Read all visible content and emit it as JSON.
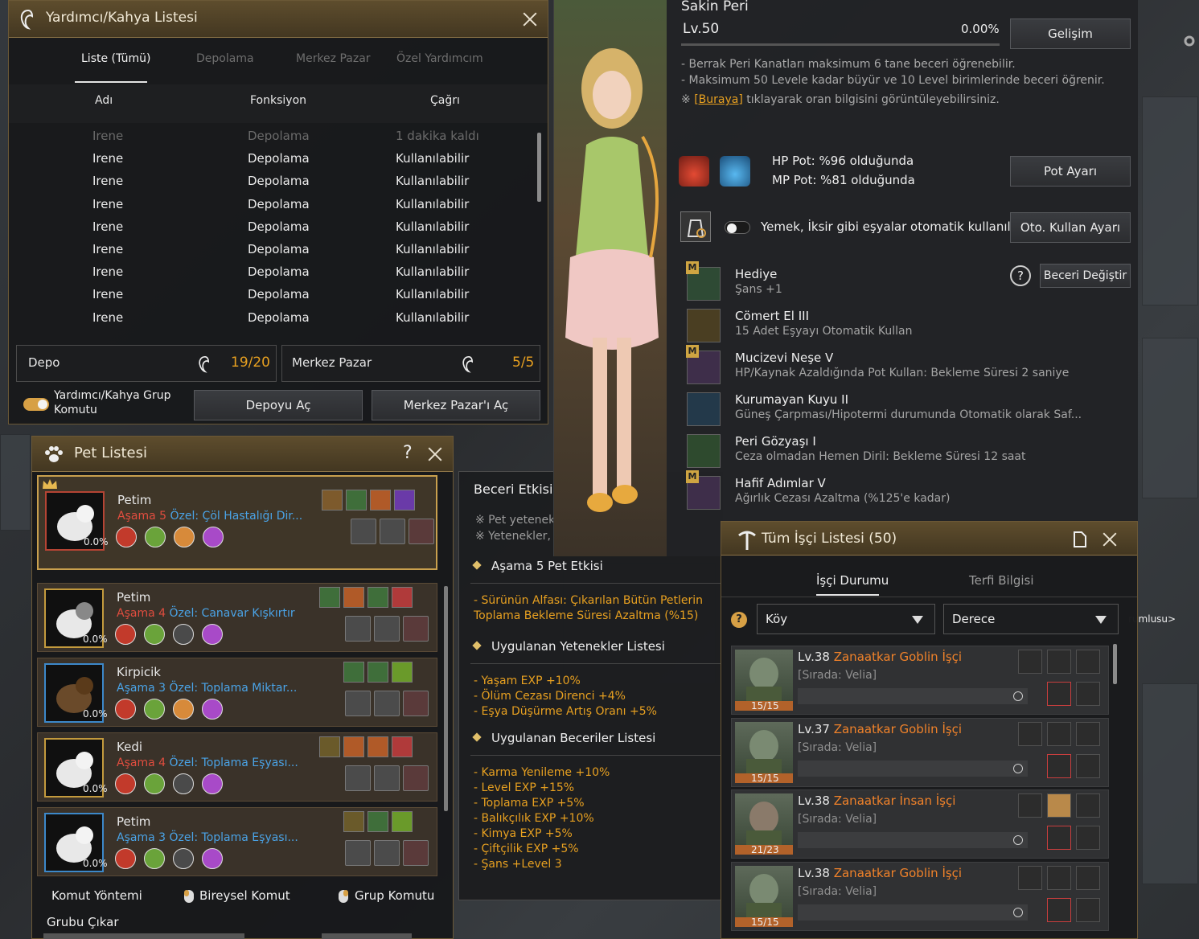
{
  "helper": {
    "title": "Yardımcı/Kahya Listesi",
    "tabs": [
      "Liste (Tümü)",
      "Depolama",
      "Merkez Pazar",
      "Özel Yardımcım"
    ],
    "columns": [
      "Adı",
      "Fonksiyon",
      "Çağrı"
    ],
    "rows": [
      {
        "name": "Irene",
        "function": "Depolama",
        "call": "1 dakika kaldı",
        "dim": true
      },
      {
        "name": "Irene",
        "function": "Depolama",
        "call": "Kullanılabilir"
      },
      {
        "name": "Irene",
        "function": "Depolama",
        "call": "Kullanılabilir"
      },
      {
        "name": "Irene",
        "function": "Depolama",
        "call": "Kullanılabilir"
      },
      {
        "name": "Irene",
        "function": "Depolama",
        "call": "Kullanılabilir"
      },
      {
        "name": "Irene",
        "function": "Depolama",
        "call": "Kullanılabilir"
      },
      {
        "name": "Irene",
        "function": "Depolama",
        "call": "Kullanılabilir"
      },
      {
        "name": "Irene",
        "function": "Depolama",
        "call": "Kullanılabilir"
      },
      {
        "name": "Irene",
        "function": "Depolama",
        "call": "Kullanılabilir"
      }
    ],
    "storage_label": "Depo",
    "storage_count": "19/20",
    "market_label": "Merkez Pazar",
    "market_count": "5/5",
    "group_command_label": "Yardımcı/Kahya Grup Komutu",
    "open_storage": "Depoyu Aç",
    "open_market": "Merkez Pazar'ı Aç"
  },
  "pets": {
    "title": "Pet Listesi",
    "help": "?",
    "items": [
      {
        "name": "Petim",
        "stage_label": "Aşama",
        "stage": "5",
        "special": "Özel: Çöl Hastalığı Dir...",
        "pct": "0.0%",
        "stage_color": "#e14d3f"
      },
      {
        "name": "Petim",
        "stage_label": "Aşama",
        "stage": "4",
        "special": "Özel: Canavar Kışkırtır",
        "pct": "0.0%",
        "stage_color": "#e14d3f"
      },
      {
        "name": "Kirpicik",
        "stage_label": "Aşama",
        "stage": "3",
        "special": "Özel: Toplama Miktar...",
        "pct": "0.0%",
        "stage_color": "#4aa3e6"
      },
      {
        "name": "Kedi",
        "stage_label": "Aşama",
        "stage": "4",
        "special": "Özel: Toplama Eşyası...",
        "pct": "0.0%",
        "stage_color": "#e14d3f"
      },
      {
        "name": "Petim",
        "stage_label": "Aşama",
        "stage": "3",
        "special": "Özel: Toplama Eşyası...",
        "pct": "0.0%",
        "stage_color": "#4aa3e6"
      }
    ],
    "command_method": "Komut Yöntemi",
    "individual_command": "Bireysel Komut",
    "group_command": "Grup Komutu",
    "remove_group": "Grubu Çıkar"
  },
  "skill_effect": {
    "title": "Beceri Etkisi",
    "notes": [
      "※ Pet yetenek",
      "※ Yetenekler,"
    ],
    "stage_effect_title": "Aşama 5 Pet Etkisi",
    "stage_effect_text": [
      "- Sürünün Alfası: Çıkarılan Bütün Petlerin",
      "Toplama Bekleme Süresi Azaltma (%15)"
    ],
    "applied_talents_title": "Uygulanan Yetenekler Listesi",
    "applied_talents": [
      "- Yaşam EXP +10%",
      "- Ölüm Cezası Direnci +4%",
      "- Eşya Düşürme Artış Oranı +5%"
    ],
    "applied_skills_title": "Uygulanan Beceriler Listesi",
    "applied_skills": [
      "- Karma Yenileme +10%",
      "- Level EXP +15%",
      "- Toplama EXP +5%",
      "- Balıkçılık EXP +10%",
      "- Kimya EXP +5%",
      "- Çiftçilik EXP +5%",
      "- Şans +Level 3"
    ]
  },
  "fairy": {
    "name": "Sakin Peri",
    "level": "Lv.50",
    "percent": "0.00%",
    "grow_button": "Gelişim",
    "info": [
      "- Berrak Peri Kanatları maksimum 6 tane beceri öğrenebilir.",
      "- Maksimum 50 Levele kadar büyür ve 10 Level birimlerinde beceri öğrenir."
    ],
    "link_prefix": "※ ",
    "link_text": "[Buraya]",
    "link_suffix": " tıklayarak oran bilgisini görüntüleyebilirsiniz.",
    "hp_pot": "HP Pot: %96 olduğunda",
    "mp_pot": "MP Pot: %81 olduğunda",
    "pot_button": "Pot Ayarı",
    "auto_use_text": "Yemek, İksir gibi eşyalar otomatik kullanılır.",
    "auto_use_button": "Oto. Kullan Ayarı",
    "change_skill_button": "Beceri Değiştir",
    "skills": [
      {
        "name": "Hediye",
        "desc": "Şans +1",
        "badge": "M",
        "icon": "clover-icon"
      },
      {
        "name": "Cömert El III",
        "desc": "15 Adet Eşyayı Otomatik Kullan",
        "badge": "",
        "icon": "fairy-hand-icon"
      },
      {
        "name": "Mucizevi Neşe V",
        "desc": "HP/Kaynak Azaldığında Pot Kullan: Bekleme Süresi 2 saniye",
        "badge": "M",
        "icon": "potion-plus-icon"
      },
      {
        "name": "Kurumayan Kuyu II",
        "desc": "Güneş Çarpması/Hipotermi durumunda Otomatik olarak Saf...",
        "badge": "",
        "icon": "bowl-icon"
      },
      {
        "name": "Peri Gözyaşı I",
        "desc": "Ceza olmadan Hemen Diril: Bekleme Süresi 12 saat",
        "badge": "",
        "icon": "tear-icon"
      },
      {
        "name": "Hafif Adımlar V",
        "desc": "Ağırlık Cezası Azaltma (%125'e kadar)",
        "badge": "M",
        "icon": "feather-weight-icon"
      }
    ]
  },
  "workers": {
    "title": "Tüm İşçi Listesi (50)",
    "tabs": [
      "İşçi Durumu",
      "Terfi Bilgisi"
    ],
    "filter_town": "Köy",
    "filter_grade": "Derece",
    "items": [
      {
        "level": "Lv.38",
        "name": "Zanaatkar Goblin İşçi",
        "status": "[Sırada: Velia]",
        "stamina": "15/15"
      },
      {
        "level": "Lv.37",
        "name": "Zanaatkar Goblin İşçi",
        "status": "[Sırada: Velia]",
        "stamina": "15/15"
      },
      {
        "level": "Lv.38",
        "name": "Zanaatkar İnsan İşçi",
        "status": "[Sırada: Velia]",
        "stamina": "21/23"
      },
      {
        "level": "Lv.38",
        "name": "Zanaatkar Goblin İşçi",
        "status": "[Sırada: Velia]",
        "stamina": "15/15"
      }
    ]
  },
  "background": {
    "side_text": "rumlusu>"
  }
}
